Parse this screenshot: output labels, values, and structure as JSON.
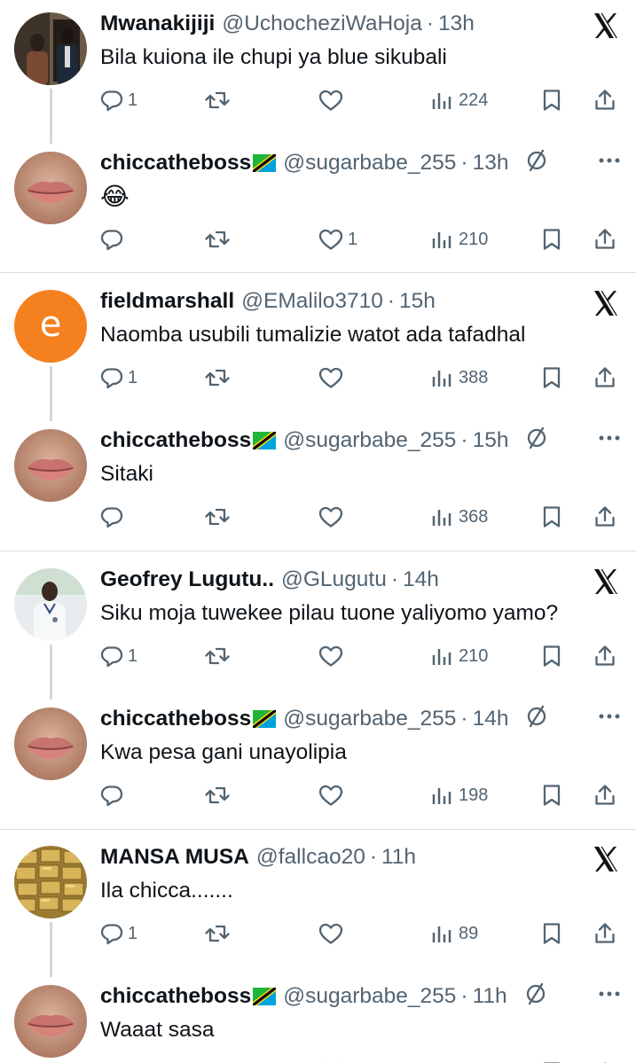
{
  "colors": {
    "text": "#0f1419",
    "muted": "#536471",
    "divider": "#d6dade",
    "connector": "#cfd9de",
    "letter_avatar": "#f4801f"
  },
  "icons": {
    "reply": "speech-bubble-icon",
    "retweet": "retweet-icon",
    "like": "heart-icon",
    "views": "bar-chart-icon",
    "bookmark": "bookmark-icon",
    "share": "share-icon",
    "x_logo": "x-logo-icon",
    "muted": "bell-slash-icon",
    "more": "ellipsis-icon"
  },
  "threads": [
    {
      "parent": {
        "name": "Mwanakijiji",
        "handle": "@UchocheziWaHoja",
        "dot": "·",
        "time": "13h",
        "text": "Bila kuiona ile chupi ya blue sikubali",
        "replies": "1",
        "retweets": "",
        "likes": "",
        "views": "224"
      },
      "reply": {
        "name": "chiccatheboss",
        "handle": "@sugarbabe_255",
        "dot": "·",
        "time": "13h",
        "text": "😂",
        "replies": "",
        "retweets": "",
        "likes": "1",
        "views": "210"
      }
    },
    {
      "parent": {
        "name": "fieldmarshall",
        "handle": "@EMalilo3710",
        "dot": "·",
        "time": "15h",
        "text": "Naomba usubili tumalizie watot ada tafadhal",
        "avatar_letter": "e",
        "replies": "1",
        "retweets": "",
        "likes": "",
        "views": "388"
      },
      "reply": {
        "name": "chiccatheboss",
        "handle": "@sugarbabe_255",
        "dot": "·",
        "time": "15h",
        "text": "Sitaki",
        "replies": "",
        "retweets": "",
        "likes": "",
        "views": "368"
      }
    },
    {
      "parent": {
        "name": "Geofrey Lugutu..",
        "handle": "@GLugutu",
        "dot": "·",
        "time": "14h",
        "text": "Siku moja tuwekee pilau tuone yaliyomo yamo?",
        "replies": "1",
        "retweets": "",
        "likes": "",
        "views": "210"
      },
      "reply": {
        "name": "chiccatheboss",
        "handle": "@sugarbabe_255",
        "dot": "·",
        "time": "14h",
        "text": "Kwa pesa gani unayolipia",
        "replies": "",
        "retweets": "",
        "likes": "",
        "views": "198"
      }
    },
    {
      "parent": {
        "name": "MANSA MUSA",
        "handle": "@fallcao20",
        "dot": "·",
        "time": "11h",
        "text": "Ila chicca.......",
        "replies": "1",
        "retweets": "",
        "likes": "",
        "views": "89"
      },
      "reply": {
        "name": "chiccatheboss",
        "handle": "@sugarbabe_255",
        "dot": "·",
        "time": "11h",
        "text": "Waaat sasa",
        "replies": "",
        "retweets": "",
        "likes": "",
        "views": ""
      }
    }
  ]
}
